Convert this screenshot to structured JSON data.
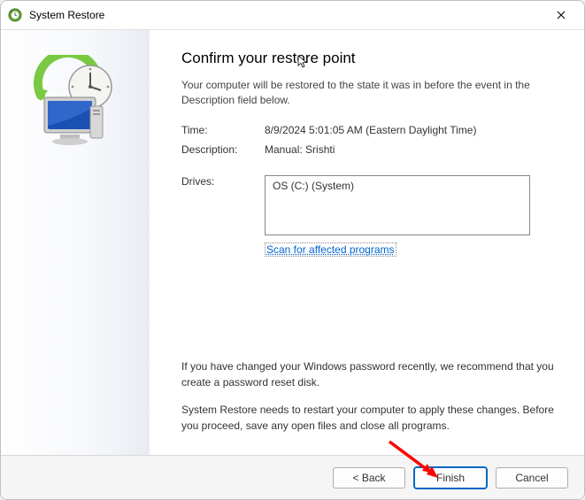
{
  "window": {
    "title": "System Restore"
  },
  "main": {
    "heading": "Confirm your restore point",
    "intro": "Your computer will be restored to the state it was in before the event in the Description field below.",
    "time_label": "Time:",
    "time_value": "8/9/2024 5:01:05 AM (Eastern Daylight Time)",
    "description_label": "Description:",
    "description_value": "Manual: Srishti",
    "drives_label": "Drives:",
    "drives_value": "OS (C:) (System)",
    "scan_link": "Scan for affected programs",
    "note1": "If you have changed your Windows password recently, we recommend that you create a password reset disk.",
    "note2": "System Restore needs to restart your computer to apply these changes. Before you proceed, save any open files and close all programs."
  },
  "footer": {
    "back": "< Back",
    "finish": "Finish",
    "cancel": "Cancel"
  }
}
